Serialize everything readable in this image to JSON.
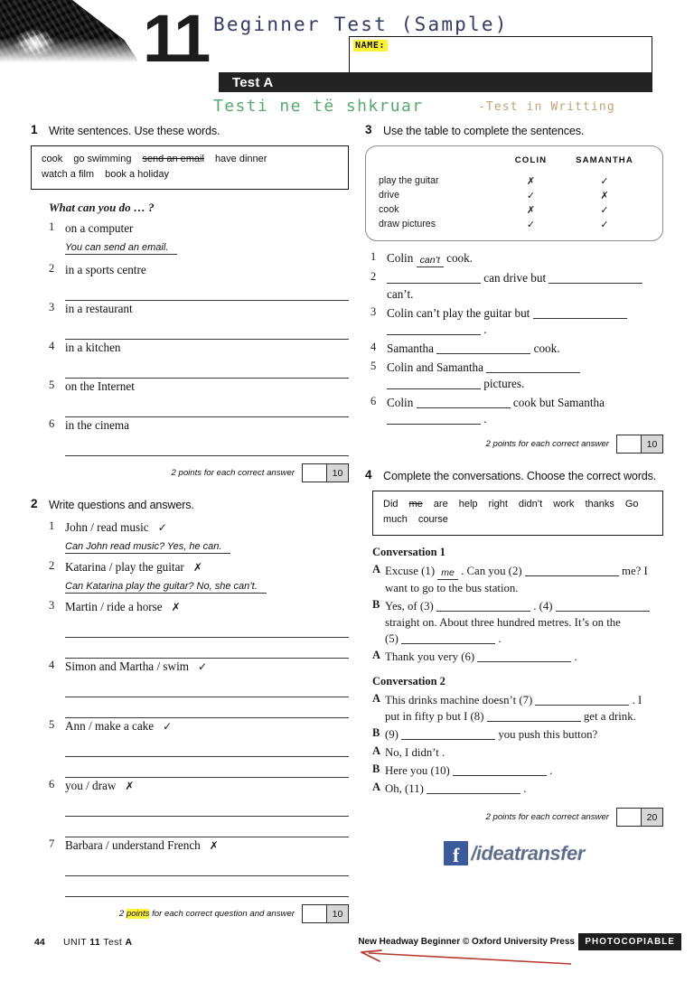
{
  "header": {
    "unit_number": "11",
    "title": "Beginner Test (Sample)",
    "name_label": "NAME:",
    "test_bar": "Test A",
    "subtitle_albanian": "Testi ne të shkruar",
    "subtitle_english": "-Test in Writting",
    "title_color": "#333b63",
    "albanian_color": "#5aa86f",
    "english_color": "#c2a276",
    "highlight_color": "#fdf238"
  },
  "ex1": {
    "number": "1",
    "title": "Write sentences. Use these words.",
    "wordbank": [
      {
        "text": "cook",
        "struck": false
      },
      {
        "text": "go swimming",
        "struck": false
      },
      {
        "text": "send an email",
        "struck": true
      },
      {
        "text": "have dinner",
        "struck": false
      },
      {
        "text": "watch a film",
        "struck": false
      },
      {
        "text": "book a holiday",
        "struck": false
      }
    ],
    "prompt": "What can you do … ?",
    "items": [
      {
        "n": "1",
        "text": "on a computer",
        "answer": "You can send an email.",
        "lines": 0
      },
      {
        "n": "2",
        "text": "in a sports centre",
        "answer": "",
        "lines": 1
      },
      {
        "n": "3",
        "text": "in a restaurant",
        "answer": "",
        "lines": 1
      },
      {
        "n": "4",
        "text": "in a kitchen",
        "answer": "",
        "lines": 1
      },
      {
        "n": "5",
        "text": "on the Internet",
        "answer": "",
        "lines": 1
      },
      {
        "n": "6",
        "text": "in the cinema",
        "answer": "",
        "lines": 1
      }
    ],
    "score_label": "2 points for each correct answer",
    "score_total": "10"
  },
  "ex2": {
    "number": "2",
    "title": "Write questions and answers.",
    "items": [
      {
        "n": "1",
        "text": "John / read music",
        "mark": "✓",
        "answer": "Can John read music? Yes, he can.",
        "lines": 0
      },
      {
        "n": "2",
        "text": "Katarina / play the guitar",
        "mark": "✗",
        "answer": "Can Katarina play the guitar? No, she can’t.",
        "lines": 0
      },
      {
        "n": "3",
        "text": "Martin / ride a horse",
        "mark": "✗",
        "answer": "",
        "lines": 2
      },
      {
        "n": "4",
        "text": "Simon and Martha / swim",
        "mark": "✓",
        "answer": "",
        "lines": 2
      },
      {
        "n": "5",
        "text": "Ann / make a cake",
        "mark": "✓",
        "answer": "",
        "lines": 2
      },
      {
        "n": "6",
        "text": "you / draw",
        "mark": "✗",
        "answer": "",
        "lines": 2
      },
      {
        "n": "7",
        "text": "Barbara / understand French",
        "mark": "✗",
        "answer": "",
        "lines": 2
      }
    ],
    "score_label_pre": "2 ",
    "score_label_hl": "points",
    "score_label_post": " for each correct question and answer",
    "score_total": "10"
  },
  "ex3": {
    "number": "3",
    "title": "Use the table to complete the sentences.",
    "table": {
      "columns": [
        "",
        "COLIN",
        "SAMANTHA"
      ],
      "rows": [
        {
          "label": "play the guitar",
          "colin": "✗",
          "samantha": "✓"
        },
        {
          "label": "drive",
          "colin": "✓",
          "samantha": "✗"
        },
        {
          "label": "cook",
          "colin": "✗",
          "samantha": "✓"
        },
        {
          "label": "draw pictures",
          "colin": "✓",
          "samantha": "✓"
        }
      ]
    },
    "sentences": [
      {
        "n": "1",
        "parts": [
          {
            "t": "Colin "
          },
          {
            "fill": "can’t"
          },
          {
            "t": " cook."
          }
        ]
      },
      {
        "n": "2",
        "parts": [
          {
            "gap": "l"
          },
          {
            "t": " can drive but "
          },
          {
            "gap": "l"
          },
          {
            "t": " can’t."
          }
        ]
      },
      {
        "n": "3",
        "parts": [
          {
            "t": "Colin can’t play the guitar but "
          },
          {
            "gap": "l"
          },
          {
            "gap": "l"
          },
          {
            "t": " ."
          }
        ]
      },
      {
        "n": "4",
        "parts": [
          {
            "t": "Samantha "
          },
          {
            "gap": "l"
          },
          {
            "t": " cook."
          }
        ]
      },
      {
        "n": "5",
        "parts": [
          {
            "t": "Colin and Samantha "
          },
          {
            "gap": "l"
          },
          {
            "gap": "l"
          },
          {
            "t": " pictures."
          }
        ]
      },
      {
        "n": "6",
        "parts": [
          {
            "t": "Colin "
          },
          {
            "gap": "l"
          },
          {
            "t": " cook but Samantha "
          },
          {
            "gap": "l"
          },
          {
            "t": " ."
          }
        ]
      }
    ],
    "score_label": "2 points for each correct answer",
    "score_total": "10"
  },
  "ex4": {
    "number": "4",
    "title": "Complete the conversations. Choose the correct words.",
    "wordbank": [
      {
        "text": "Did",
        "struck": false
      },
      {
        "text": "me",
        "struck": true
      },
      {
        "text": "are",
        "struck": false
      },
      {
        "text": "help",
        "struck": false
      },
      {
        "text": "right",
        "struck": false
      },
      {
        "text": "didn’t",
        "struck": false
      },
      {
        "text": "work",
        "struck": false
      },
      {
        "text": "thanks",
        "struck": false
      },
      {
        "text": "Go",
        "struck": false
      },
      {
        "text": "much",
        "struck": false
      },
      {
        "text": "course",
        "struck": false
      }
    ],
    "conversation1_title": "Conversation 1",
    "conversation1": [
      {
        "speaker": "A",
        "text": "Excuse (1) me . Can you (2) ______ me? I want to go to the bus station."
      },
      {
        "speaker": "B",
        "text": "Yes, of (3) ______ . (4) ______ straight on. About three hundred metres. It’s on the (5) ______ ."
      },
      {
        "speaker": "A",
        "text": "Thank you very (6) ______ ."
      }
    ],
    "conversation2_title": "Conversation 2",
    "conversation2": [
      {
        "speaker": "A",
        "text": "This drinks machine doesn’t (7) ______ . I put in fifty p but I (8) ______ get a drink."
      },
      {
        "speaker": "B",
        "text": "(9) ______ you push this button?"
      },
      {
        "speaker": "A",
        "text": "No, I didn’t ."
      },
      {
        "speaker": "B",
        "text": "Here you (10) ______ ."
      },
      {
        "speaker": "A",
        "text": "Oh, (11) ______ ."
      }
    ],
    "score_label": "2 points for each correct answer",
    "score_total": "20"
  },
  "social": {
    "icon": "facebook-icon",
    "mark": "f",
    "handle": "/ideatransfer",
    "brand_color": "#3b5a9b"
  },
  "footer": {
    "page_number": "44",
    "unit_word": "UNIT",
    "unit_number": "11",
    "test_word": "Test",
    "test_letter": "A",
    "credit": "New Headway Beginner  © Oxford University Press",
    "photocopiable": "PHOTOCOPIABLE",
    "annotation_arrow_color": "#b8392f"
  }
}
